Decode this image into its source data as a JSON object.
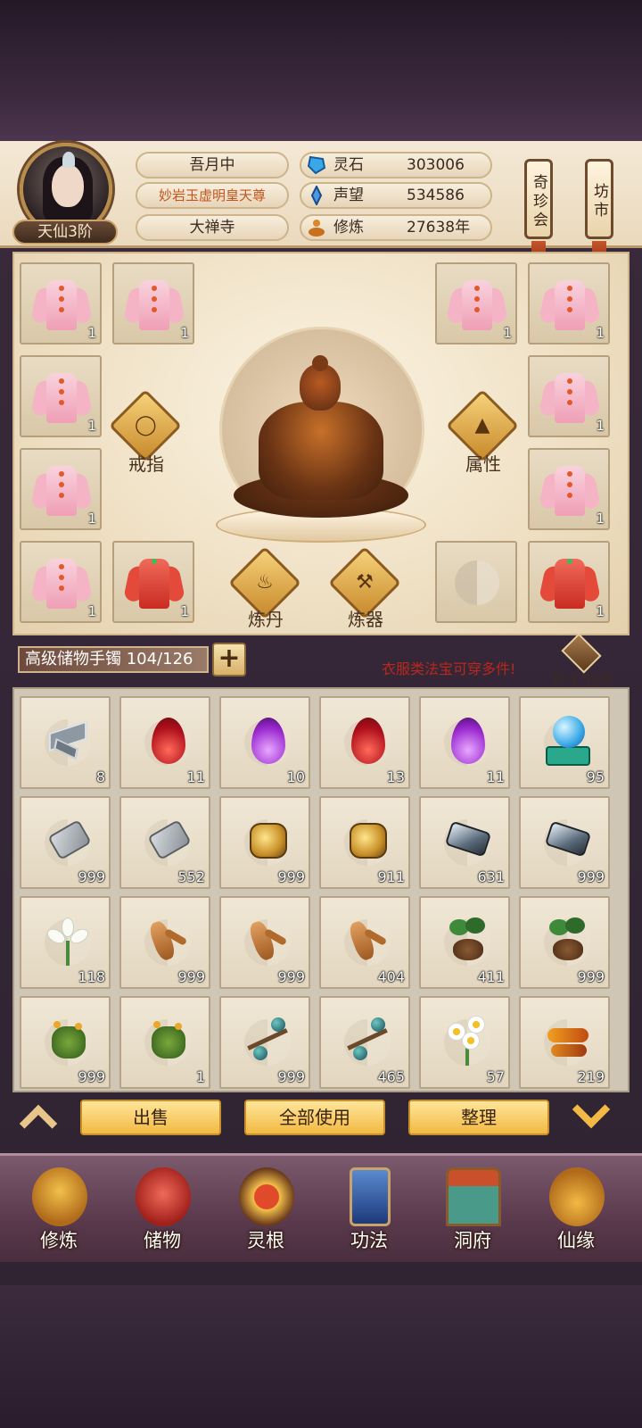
{
  "player": {
    "rank": "天仙3阶",
    "name": "吾月中",
    "title": "妙岩玉虚明皇天尊",
    "sect": "大禅寺"
  },
  "resources": [
    {
      "icon": "spirit-stone-icon",
      "label": "灵石",
      "value": "303006"
    },
    {
      "icon": "reputation-icon",
      "label": "声望",
      "value": "534586"
    },
    {
      "icon": "cultivation-icon",
      "label": "修炼",
      "value": "27638年"
    }
  ],
  "side_buttons": {
    "treasure_fair": "奇珍会",
    "market": "坊市"
  },
  "equipment": {
    "ring_label": "戒指",
    "attr_label": "属性",
    "alchemy_label": "炼丹",
    "forge_label": "炼器",
    "slots": [
      {
        "item": "pink-robe",
        "count": "1"
      },
      {
        "item": "pink-robe",
        "count": "1"
      },
      {
        "item": "pink-robe",
        "count": "1"
      },
      {
        "item": "pink-robe",
        "count": "1"
      },
      {
        "item": "pink-robe",
        "count": "1"
      },
      {
        "item": "pink-robe",
        "count": "1"
      },
      {
        "item": "pink-robe",
        "count": "1"
      },
      {
        "item": "pink-robe",
        "count": "1"
      },
      {
        "item": "pink-robe",
        "count": "1"
      },
      {
        "item": "red-robe",
        "count": "1"
      },
      {
        "item": "empty",
        "count": ""
      },
      {
        "item": "red-robe",
        "count": "1"
      }
    ]
  },
  "bag": {
    "name": "高级储物手镯 104/126",
    "plus": "+",
    "tip": "衣服类法宝可穿多件!",
    "mustard_space": "芥子空间"
  },
  "inventory": [
    {
      "item": "silver-shards",
      "count": "8"
    },
    {
      "item": "red-flame",
      "count": "11"
    },
    {
      "item": "purple-flame",
      "count": "10"
    },
    {
      "item": "red-flame",
      "count": "13"
    },
    {
      "item": "purple-flame",
      "count": "11"
    },
    {
      "item": "spirit-orb-stand",
      "count": "95"
    },
    {
      "item": "grey-stone",
      "count": "999"
    },
    {
      "item": "grey-stone",
      "count": "552"
    },
    {
      "item": "gold-ore",
      "count": "999"
    },
    {
      "item": "gold-ore",
      "count": "911"
    },
    {
      "item": "iron-ore",
      "count": "631"
    },
    {
      "item": "iron-ore",
      "count": "999"
    },
    {
      "item": "white-lily",
      "count": "118"
    },
    {
      "item": "ginseng-root",
      "count": "999"
    },
    {
      "item": "ginseng-root",
      "count": "999"
    },
    {
      "item": "ginseng-root",
      "count": "404"
    },
    {
      "item": "leafy-tuber",
      "count": "411"
    },
    {
      "item": "leafy-tuber",
      "count": "999"
    },
    {
      "item": "flowering-herb",
      "count": "999"
    },
    {
      "item": "flowering-herb",
      "count": "1"
    },
    {
      "item": "berry-branch",
      "count": "999"
    },
    {
      "item": "berry-branch",
      "count": "465"
    },
    {
      "item": "white-daisy",
      "count": "57"
    },
    {
      "item": "fire-worm",
      "count": "219"
    }
  ],
  "actions": {
    "sell": "出售",
    "use_all": "全部使用",
    "sort": "整理"
  },
  "nav": [
    {
      "label": "修炼",
      "icon": "meditating-monk-icon"
    },
    {
      "label": "储物",
      "icon": "storage-bag-icon"
    },
    {
      "label": "灵根",
      "icon": "spirit-root-icon"
    },
    {
      "label": "功法",
      "icon": "scripture-book-icon"
    },
    {
      "label": "洞府",
      "icon": "cave-dwelling-icon"
    },
    {
      "label": "仙缘",
      "icon": "gourd-icon"
    }
  ],
  "colors": {
    "accent_gold": "#f2b944",
    "tip_red": "#b8281c",
    "title_orange": "#c2561e"
  }
}
